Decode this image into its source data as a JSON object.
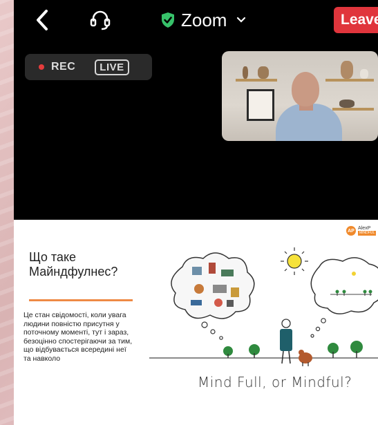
{
  "topbar": {
    "back_icon": "chevron-left-icon",
    "audio_icon": "headset-icon",
    "security_icon": "shield-check-icon",
    "app_title": "Zoom",
    "leave_label": "Leave",
    "colors": {
      "security": "#37c26a",
      "leave": "#e0353c"
    }
  },
  "recording": {
    "rec_label": "REC",
    "live_label": "LIVE",
    "rec_color": "#e53c3c"
  },
  "speaker_video": {
    "icon": "participant-video-thumbnail"
  },
  "slide": {
    "logo_text": "AlexP",
    "logo_sub": "MINDFUL",
    "title": "Що таке\nМайндфулнес?",
    "body": "Це стан свідомості, коли увага\nлюдини повністю присутня у\nпоточному моменті, тут і зараз,\nбезоцінно спостерігаючи за тим,\nщо відбувається всередині неї\nта навколо",
    "caption": "Mind Full, or Mindful?",
    "accent_color": "#ee8a45"
  }
}
